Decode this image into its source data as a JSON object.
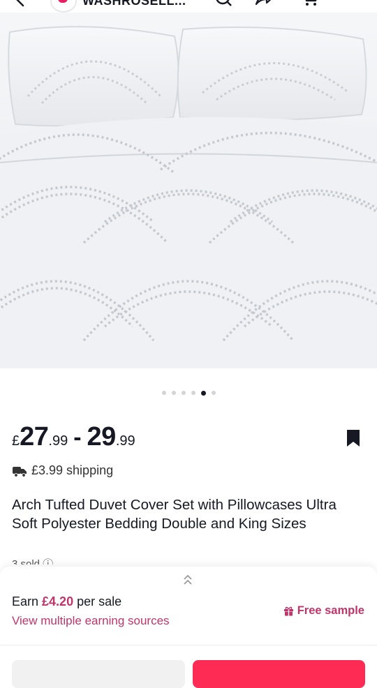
{
  "header": {
    "shop_name": "WASHROSELL...",
    "icons": [
      "back-arrow-icon",
      "shop-logo",
      "search-icon",
      "share-icon",
      "cart-icon"
    ]
  },
  "gallery": {
    "image_count": 6,
    "active_index": 4
  },
  "price": {
    "currency": "£",
    "min_whole": "27",
    "min_decimal": ".99",
    "separator": "-",
    "max_whole": "29",
    "max_decimal": ".99"
  },
  "shipping": {
    "text": "£3.99 shipping",
    "icon": "truck-icon"
  },
  "product": {
    "title": "Arch Tufted Duvet Cover Set with Pillowcases Ultra Soft Polyester Bedding Double and King Sizes",
    "sold": "3 sold ⓘ"
  },
  "earn": {
    "prefix": "Earn ",
    "amount": "£4.20",
    "suffix": " per sale",
    "link": "View multiple earning sources",
    "free_sample": "Free sample"
  },
  "colors": {
    "accent": "#c0346a",
    "primary_button": "#fe2c55",
    "text": "#161823"
  }
}
